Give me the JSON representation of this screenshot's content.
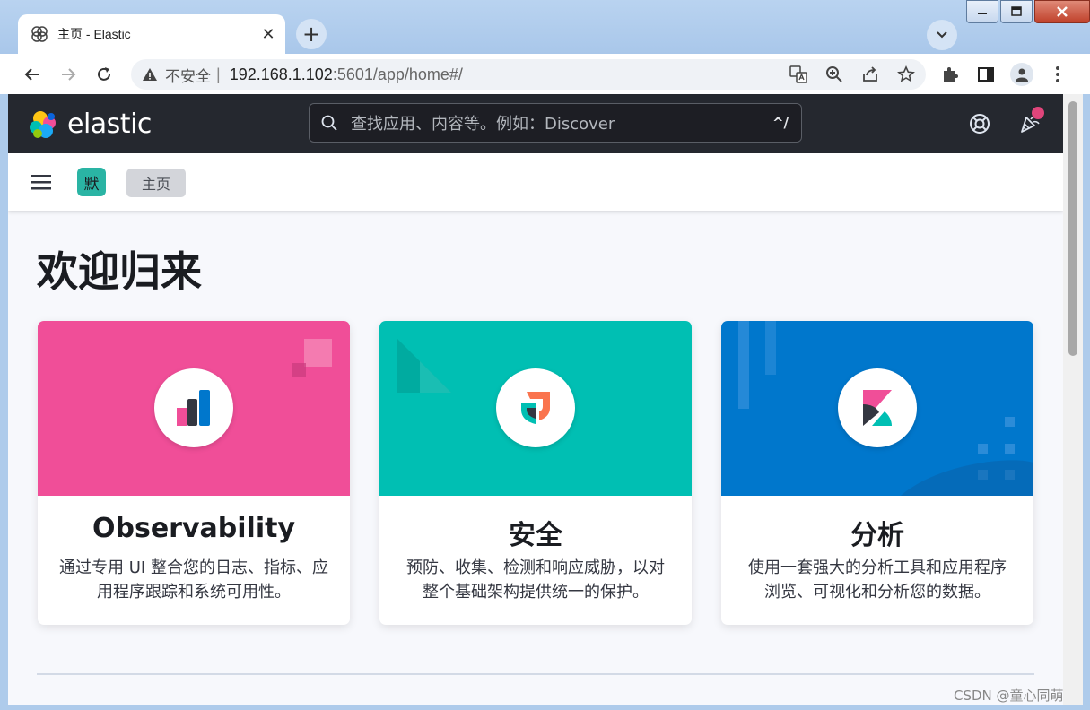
{
  "browser": {
    "tab_title": "主页 - Elastic",
    "tab_close": "✕",
    "new_tab": "+",
    "insecure_label": "不安全",
    "separator": "|",
    "url_host": "192.168.1.102",
    "url_path": ":5601/app/home#/"
  },
  "header": {
    "logo_text": "elastic",
    "search_placeholder": "查找应用、内容等。例如：Discover",
    "search_shortcut": "^/"
  },
  "breadcrumbs": {
    "space_initial": "默",
    "current": "主页"
  },
  "main": {
    "welcome": "欢迎归来",
    "cards": [
      {
        "title": "Observability",
        "description": "通过专用 UI 整合您的日志、指标、应用程序跟踪和系统可用性。",
        "color": "#f04e98"
      },
      {
        "title": "安全",
        "description": "预防、收集、检测和响应威胁，以对整个基础架构提供统一的保护。",
        "color": "#00bfb3"
      },
      {
        "title": "分析",
        "description": "使用一套强大的分析工具和应用程序浏览、可视化和分析您的数据。",
        "color": "#0077cc"
      }
    ]
  },
  "watermark": "CSDN @童心同萌",
  "colors": {
    "header_bg": "#25282f",
    "page_bg": "#f7f8fc",
    "space_avatar": "#2ab4a4",
    "news_dot": "#e0457b"
  }
}
